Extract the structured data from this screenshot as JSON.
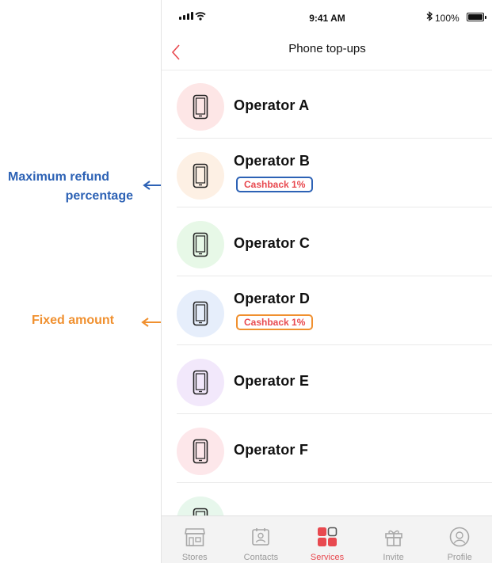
{
  "status": {
    "time": "9:41 AM",
    "battery": "100%"
  },
  "nav": {
    "title": "Phone top-ups"
  },
  "operators": [
    {
      "name": "Operator A",
      "color": "#fde6e6",
      "badge": ""
    },
    {
      "name": "Operator B",
      "color": "#fdf0e4",
      "badge": "Cashback 1%"
    },
    {
      "name": "Operator C",
      "color": "#e7f8e7",
      "badge": ""
    },
    {
      "name": "Operator D",
      "color": "#e6eefb",
      "badge": "Cashback 1%"
    },
    {
      "name": "Operator E",
      "color": "#f2e8fb",
      "badge": ""
    },
    {
      "name": "Operator F",
      "color": "#fde7ea",
      "badge": ""
    },
    {
      "name": "",
      "color": "#e7f7ec",
      "badge": ""
    }
  ],
  "tabs": [
    {
      "label": "Stores",
      "icon": "store-icon"
    },
    {
      "label": "Contacts",
      "icon": "contacts-icon"
    },
    {
      "label": "Services",
      "icon": "services-icon"
    },
    {
      "label": "Invite",
      "icon": "gift-icon"
    },
    {
      "label": "Profile",
      "icon": "profile-icon"
    }
  ],
  "annotations": {
    "refund_line1": "Maximum refund",
    "refund_line2": "percentage",
    "fixed": "Fixed amount"
  },
  "colors": {
    "accent": "#e8494f",
    "annotation_blue": "#2d62b5",
    "annotation_orange": "#f0902f"
  }
}
